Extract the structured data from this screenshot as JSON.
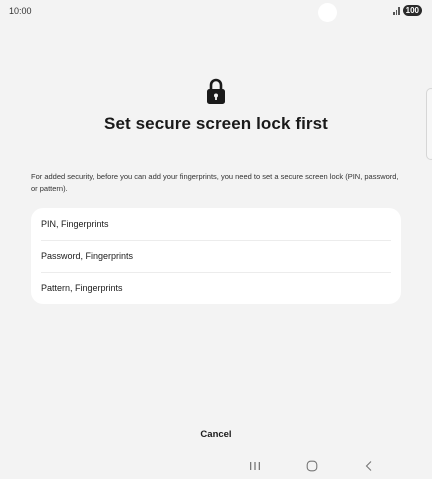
{
  "status_bar": {
    "time": "10:00",
    "battery": "100",
    "icons": [
      "signal-icon",
      "battery-icon"
    ]
  },
  "header": {
    "icon": "lock-icon",
    "title": "Set secure screen lock first"
  },
  "description": "For added security, before you can add your fingerprints, you need to set a secure screen lock (PIN, password, or pattern).",
  "options": [
    {
      "label": "PIN, Fingerprints"
    },
    {
      "label": "Password, Fingerprints"
    },
    {
      "label": "Pattern, Fingerprints"
    }
  ],
  "footer": {
    "cancel_label": "Cancel"
  },
  "nav_bar": {
    "icons": [
      "recents-icon",
      "home-icon",
      "back-icon"
    ]
  }
}
